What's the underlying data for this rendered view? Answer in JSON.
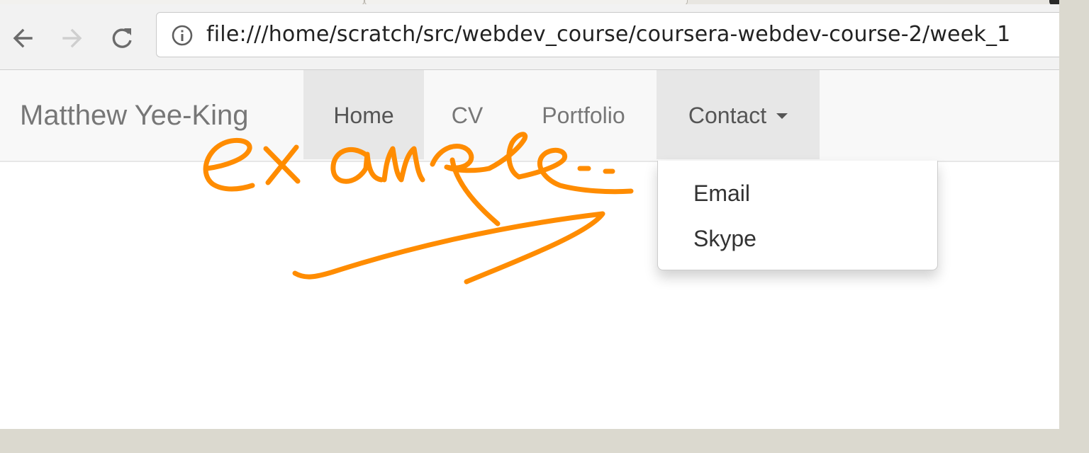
{
  "browser": {
    "url": "file:///home/scratch/src/webdev_course/coursera-webdev-course-2/week_1",
    "buttons": {
      "back_icon": "arrow-left-icon",
      "forward_icon": "arrow-right-icon",
      "reload_icon": "reload-icon",
      "site_info_icon": "info-circle-icon"
    }
  },
  "navbar": {
    "brand": "Matthew Yee-King",
    "items": [
      {
        "label": "Home",
        "active": true
      },
      {
        "label": "CV"
      },
      {
        "label": "Portfolio"
      },
      {
        "label": "Contact",
        "dropdown": true,
        "open": true
      }
    ],
    "dropdown_items": [
      "Email",
      "Skype"
    ]
  },
  "annotation": {
    "text": "example",
    "color": "#ff8c00"
  },
  "colors": {
    "navbar_bg": "#f8f8f8",
    "nav_active_bg": "#e7e7e7",
    "nav_text": "#777777",
    "annotation": "#ff8c00"
  }
}
